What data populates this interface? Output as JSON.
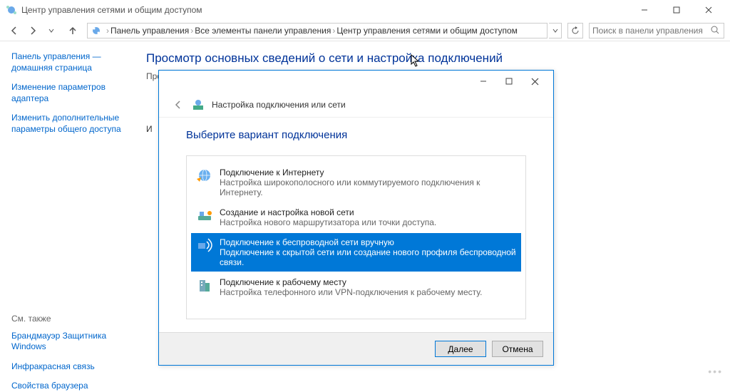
{
  "window": {
    "title": "Центр управления сетями и общим доступом"
  },
  "breadcrumb": {
    "root": "Панель управления",
    "level1": "Все элементы панели управления",
    "level2": "Центр управления сетями и общим доступом"
  },
  "search": {
    "placeholder": "Поиск в панели управления"
  },
  "sidebar": {
    "links": [
      "Панель управления — домашняя страница",
      "Изменение параметров адаптера",
      "Изменить дополнительные параметры общего доступа"
    ],
    "see_also_label": "См. также",
    "see_also": [
      "Брандмауэр Защитника Windows",
      "Инфракрасная связь",
      "Свойства браузера"
    ]
  },
  "content": {
    "heading": "Просмотр основных сведений о сети и настройка подключений",
    "sub": "Просмотр активных сетей",
    "line2": "И"
  },
  "dialog": {
    "header": "Настройка подключения или сети",
    "heading": "Выберите вариант подключения",
    "options": [
      {
        "title": "Подключение к Интернету",
        "desc": "Настройка широкополосного или коммутируемого подключения к Интернету."
      },
      {
        "title": "Создание и настройка новой сети",
        "desc": "Настройка нового маршрутизатора или точки доступа."
      },
      {
        "title": "Подключение к беспроводной сети вручную",
        "desc": "Подключение к скрытой сети или создание нового профиля беспроводной связи."
      },
      {
        "title": "Подключение к рабочему месту",
        "desc": "Настройка телефонного или VPN-подключения к рабочему месту."
      }
    ],
    "selected_index": 2,
    "buttons": {
      "next": "Далее",
      "cancel": "Отмена"
    }
  }
}
